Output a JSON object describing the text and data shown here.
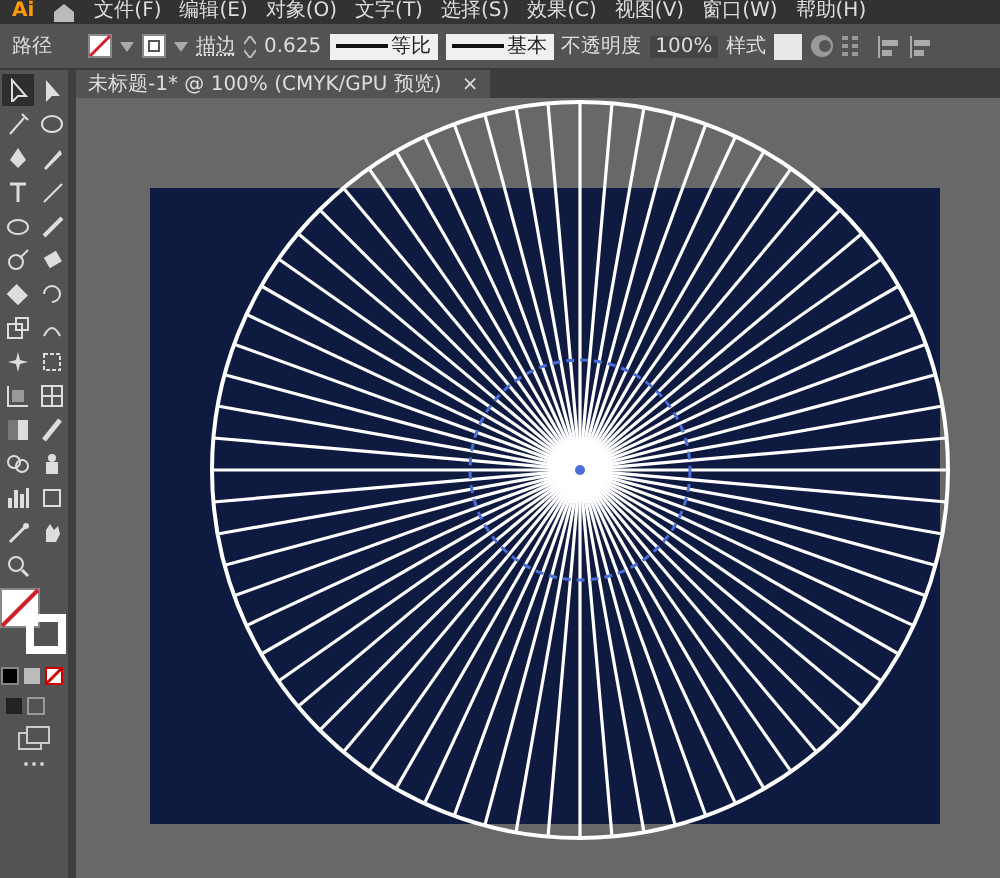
{
  "menu_bar": {
    "logo": "Ai",
    "items": [
      "文件(F)",
      "编辑(E)",
      "对象(O)",
      "文字(T)",
      "选择(S)",
      "效果(C)",
      "视图(V)",
      "窗口(W)",
      "帮助(H)"
    ]
  },
  "control_bar": {
    "object_type": "路径",
    "stroke_label": "描边",
    "stroke_weight": "0.625",
    "profile": "等比",
    "brush": "基本",
    "opacity_label": "不透明度",
    "opacity": "100%",
    "style_label": "样式"
  },
  "document_tab": {
    "title": "未标题-1* @ 100% (CMYK/GPU 预览)",
    "close": "×"
  }
}
